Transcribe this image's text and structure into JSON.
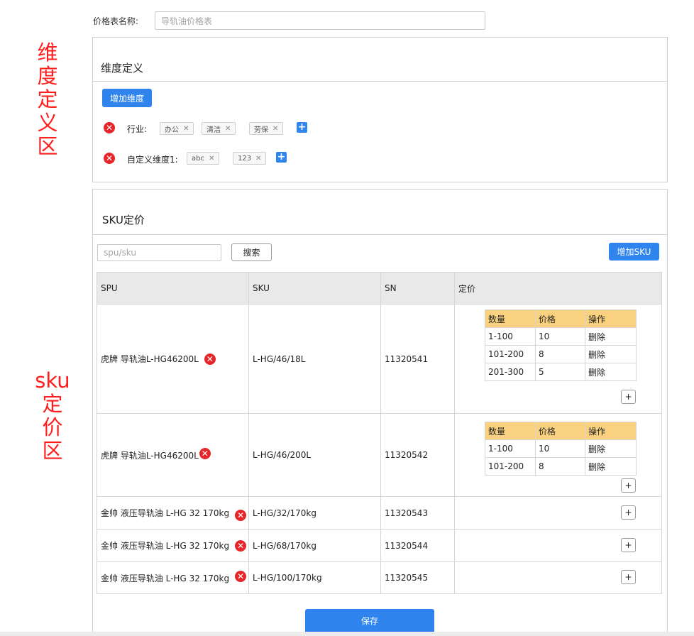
{
  "header": {
    "name_label": "价格表名称:",
    "name_placeholder": "导轨油价格表"
  },
  "annotations": {
    "dimension_area": [
      "维",
      "度",
      "定",
      "义",
      "区"
    ],
    "sku_area": [
      "sku",
      "定",
      "价",
      "区"
    ]
  },
  "dimension_panel": {
    "title": "维度定义",
    "add_button": "增加维度",
    "dimensions": [
      {
        "label": "行业:",
        "tags": [
          "办公",
          "清洁",
          "劳保"
        ]
      },
      {
        "label": "自定义维度1:",
        "tags": [
          "abc",
          "123"
        ]
      }
    ]
  },
  "sku_panel": {
    "title": "SKU定价",
    "search_placeholder": "spu/sku",
    "search_button": "搜索",
    "add_sku_button": "增加SKU",
    "columns": [
      "SPU",
      "SKU",
      "SN",
      "定价"
    ],
    "price_columns": [
      "数量",
      "价格",
      "操作"
    ],
    "rows": [
      {
        "spu": "虎牌 导轨油L-HG46200L",
        "sku": "L-HG/46/18L",
        "sn": "11320541",
        "prices": [
          [
            "1-100",
            "10",
            "删除"
          ],
          [
            "101-200",
            "8",
            "删除"
          ],
          [
            "201-300",
            "5",
            "删除"
          ]
        ]
      },
      {
        "spu": "虎牌 导轨油L-HG46200L",
        "sku": "L-HG/46/200L",
        "sn": "11320542",
        "prices": [
          [
            "1-100",
            "10",
            "删除"
          ],
          [
            "101-200",
            "8",
            "删除"
          ]
        ]
      },
      {
        "spu": "金帅 液压导轨油 L-HG 32 170kg",
        "sku": "L-HG/32/170kg",
        "sn": "11320543",
        "prices": []
      },
      {
        "spu": "金帅 液压导轨油 L-HG 32 170kg",
        "sku": "L-HG/68/170kg",
        "sn": "11320544",
        "prices": []
      },
      {
        "spu": "金帅 液压导轨油 L-HG 32 170kg",
        "sku": "L-HG/100/170kg",
        "sn": "11320545",
        "prices": []
      }
    ],
    "add_price_glyph": "+",
    "remove_glyph": "✕",
    "add_tag_glyph": "+"
  },
  "save_button": "保存"
}
